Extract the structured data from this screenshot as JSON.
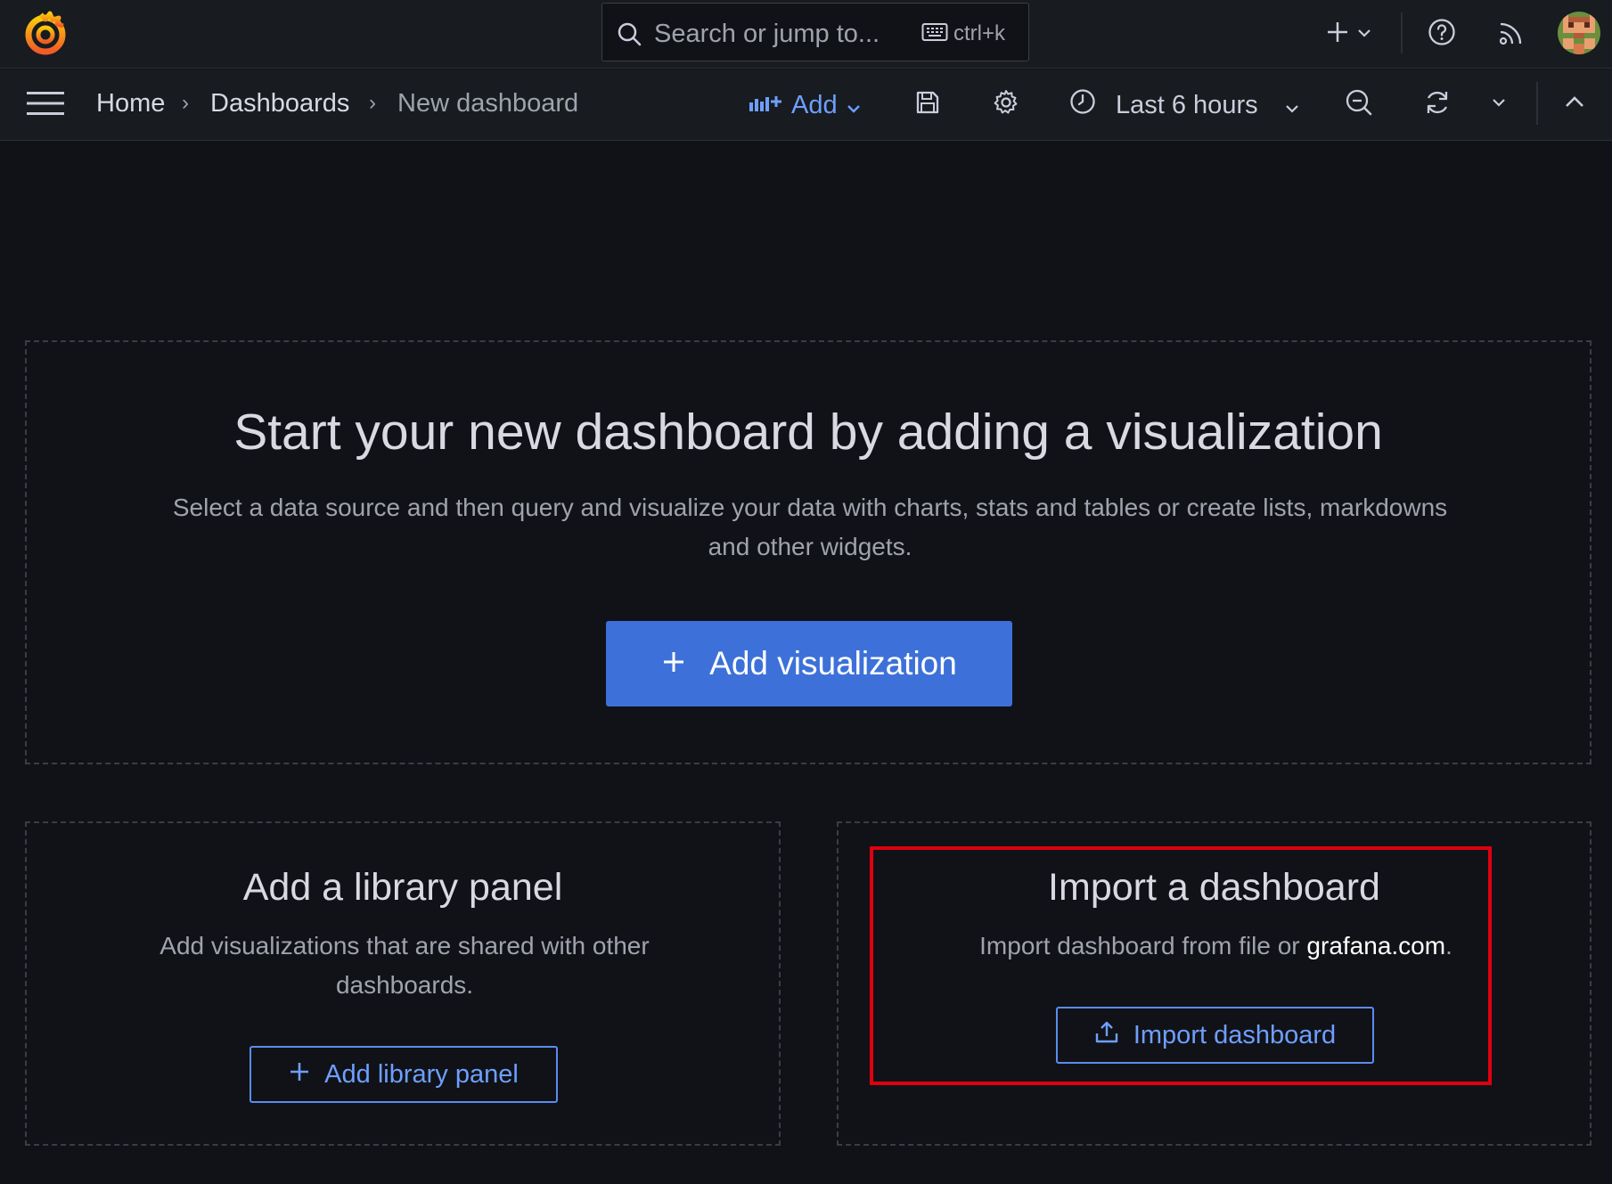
{
  "topbar": {
    "search_placeholder": "Search or jump to...",
    "search_shortcut": "ctrl+k"
  },
  "breadcrumb": {
    "items": [
      "Home",
      "Dashboards",
      "New dashboard"
    ]
  },
  "toolbar": {
    "add_label": "Add",
    "time_range": "Last 6 hours"
  },
  "main_panel": {
    "title": "Start your new dashboard by adding a visualization",
    "description": "Select a data source and then query and visualize your data with charts, stats and tables or create lists, markdowns and other widgets.",
    "button_label": "Add visualization"
  },
  "library_panel": {
    "title": "Add a library panel",
    "description": "Add visualizations that are shared with other dashboards.",
    "button_label": "Add library panel"
  },
  "import_panel": {
    "title": "Import a dashboard",
    "description_prefix": "Import dashboard from file or ",
    "description_link": "grafana.com",
    "description_suffix": ".",
    "button_label": "Import dashboard"
  },
  "colors": {
    "accent": "#3d71d9",
    "link": "#6e9fff",
    "highlight": "#e0000e"
  }
}
